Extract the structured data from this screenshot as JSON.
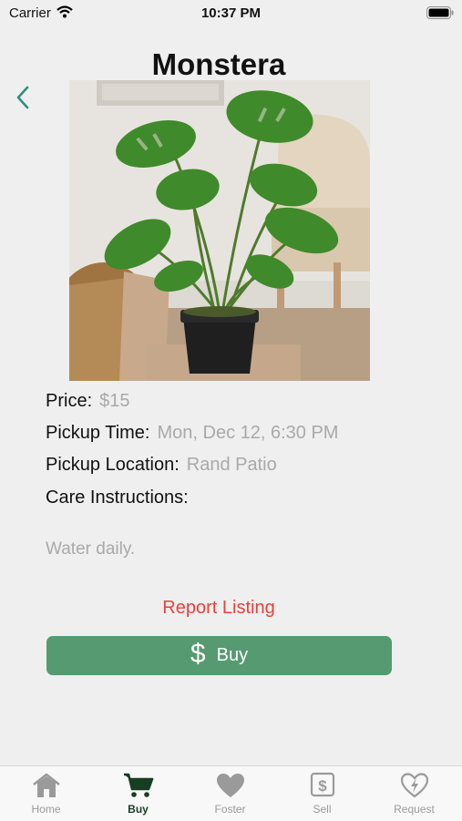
{
  "status_bar": {
    "carrier": "Carrier",
    "time": "10:37 PM"
  },
  "header": {
    "title": "Monstera"
  },
  "details": {
    "price_label": "Price:",
    "price_value": "$15",
    "pickup_time_label": "Pickup Time:",
    "pickup_time_value": "Mon, Dec 12, 6:30 PM",
    "pickup_location_label": "Pickup Location:",
    "pickup_location_value": "Rand Patio",
    "care_label": "Care Instructions:",
    "care_value": "Water daily."
  },
  "actions": {
    "report_label": "Report Listing",
    "buy_label": "Buy",
    "buy_symbol": "$"
  },
  "tabs": [
    {
      "label": "Home",
      "icon": "house-icon"
    },
    {
      "label": "Buy",
      "icon": "cart-icon",
      "active": true
    },
    {
      "label": "Foster",
      "icon": "heart-icon"
    },
    {
      "label": "Sell",
      "icon": "dollar-square-icon"
    },
    {
      "label": "Request",
      "icon": "bolt-heart-icon"
    }
  ],
  "colors": {
    "accent": "#569a72",
    "danger": "#e8423c",
    "active_tab": "#173e22",
    "muted": "#a9a9a9"
  }
}
